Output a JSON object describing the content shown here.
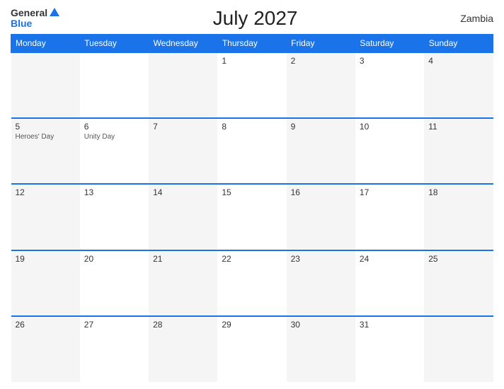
{
  "header": {
    "logo_general": "General",
    "logo_blue": "Blue",
    "title": "July 2027",
    "country": "Zambia"
  },
  "days_header": [
    "Monday",
    "Tuesday",
    "Wednesday",
    "Thursday",
    "Friday",
    "Saturday",
    "Sunday"
  ],
  "weeks": [
    [
      {
        "day": "",
        "holiday": ""
      },
      {
        "day": "",
        "holiday": ""
      },
      {
        "day": "",
        "holiday": ""
      },
      {
        "day": "1",
        "holiday": ""
      },
      {
        "day": "2",
        "holiday": ""
      },
      {
        "day": "3",
        "holiday": ""
      },
      {
        "day": "4",
        "holiday": ""
      }
    ],
    [
      {
        "day": "5",
        "holiday": "Heroes' Day"
      },
      {
        "day": "6",
        "holiday": "Unity Day"
      },
      {
        "day": "7",
        "holiday": ""
      },
      {
        "day": "8",
        "holiday": ""
      },
      {
        "day": "9",
        "holiday": ""
      },
      {
        "day": "10",
        "holiday": ""
      },
      {
        "day": "11",
        "holiday": ""
      }
    ],
    [
      {
        "day": "12",
        "holiday": ""
      },
      {
        "day": "13",
        "holiday": ""
      },
      {
        "day": "14",
        "holiday": ""
      },
      {
        "day": "15",
        "holiday": ""
      },
      {
        "day": "16",
        "holiday": ""
      },
      {
        "day": "17",
        "holiday": ""
      },
      {
        "day": "18",
        "holiday": ""
      }
    ],
    [
      {
        "day": "19",
        "holiday": ""
      },
      {
        "day": "20",
        "holiday": ""
      },
      {
        "day": "21",
        "holiday": ""
      },
      {
        "day": "22",
        "holiday": ""
      },
      {
        "day": "23",
        "holiday": ""
      },
      {
        "day": "24",
        "holiday": ""
      },
      {
        "day": "25",
        "holiday": ""
      }
    ],
    [
      {
        "day": "26",
        "holiday": ""
      },
      {
        "day": "27",
        "holiday": ""
      },
      {
        "day": "28",
        "holiday": ""
      },
      {
        "day": "29",
        "holiday": ""
      },
      {
        "day": "30",
        "holiday": ""
      },
      {
        "day": "31",
        "holiday": ""
      },
      {
        "day": "",
        "holiday": ""
      }
    ]
  ]
}
